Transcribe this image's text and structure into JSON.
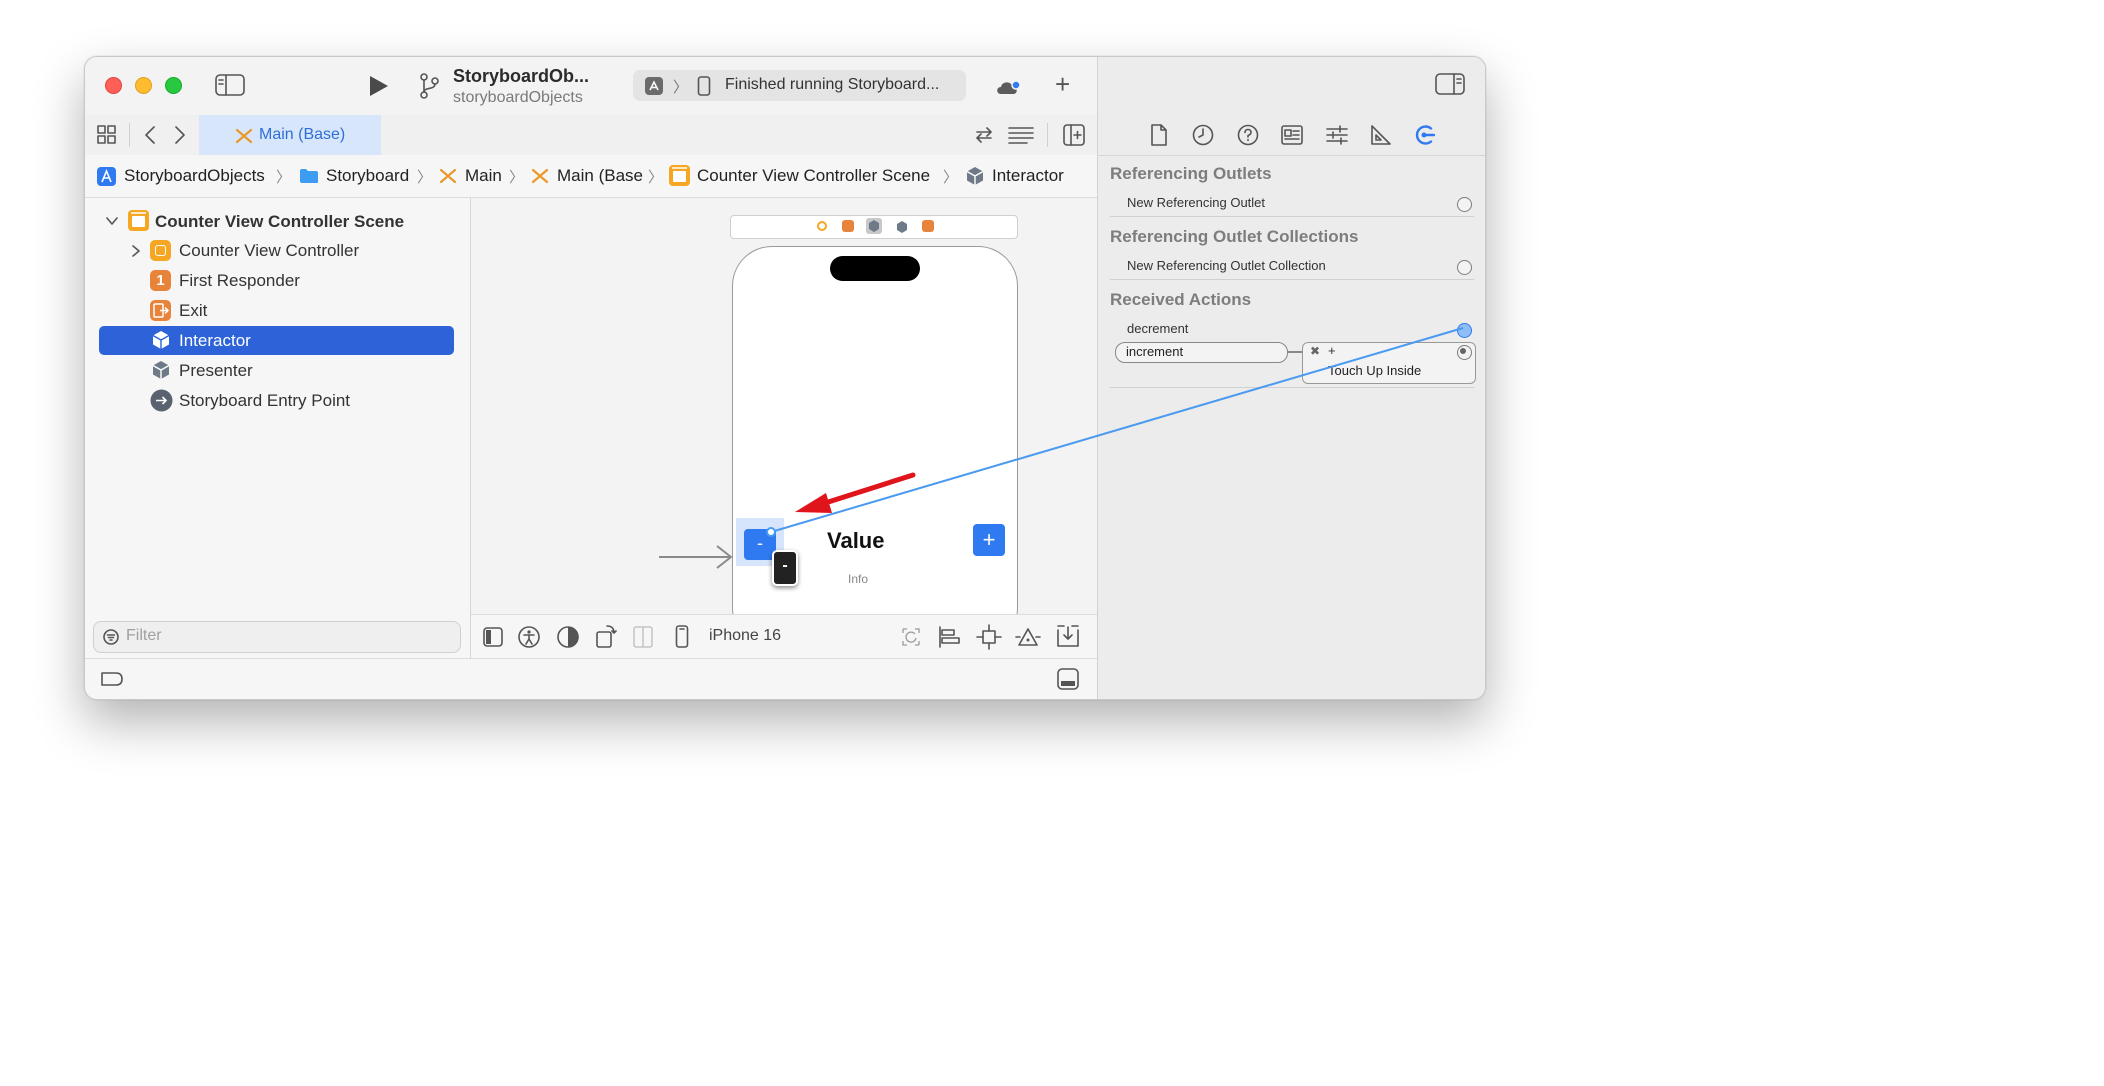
{
  "toolbar": {
    "project_name": "StoryboardOb...",
    "scheme_name": "storyboardObjects",
    "status_text": "Finished running Storyboard...",
    "add_label": "+"
  },
  "tabbar": {
    "active_tab": "Main (Base)"
  },
  "breadcrumb": [
    "StoryboardObjects",
    "Storyboard",
    "Main",
    "Main (Base",
    "Counter View Controller Scene",
    "Interactor"
  ],
  "navigator": {
    "scene": "Counter View Controller Scene",
    "items": [
      {
        "label": "Counter View Controller",
        "icon": "view-controller-icon"
      },
      {
        "label": "First Responder",
        "icon": "first-responder-icon"
      },
      {
        "label": "Exit",
        "icon": "exit-icon"
      },
      {
        "label": "Interactor",
        "icon": "object-cube-icon",
        "selected": true
      },
      {
        "label": "Presenter",
        "icon": "object-cube-icon"
      },
      {
        "label": "Storyboard Entry Point",
        "icon": "entry-point-icon"
      }
    ],
    "first_responder_badge": "1",
    "filter_placeholder": "Filter"
  },
  "canvas": {
    "minus_label": "-",
    "plus_label": "+",
    "value_label": "Value",
    "info_label": "Info",
    "tooltip_label": "-",
    "device": "iPhone 16"
  },
  "inspector": {
    "referencing_outlets_title": "Referencing Outlets",
    "new_referencing_outlet": "New Referencing Outlet",
    "referencing_outlet_collections_title": "Referencing Outlet Collections",
    "new_referencing_outlet_collection": "New Referencing Outlet Collection",
    "received_actions_title": "Received Actions",
    "actions": [
      "decrement",
      "increment"
    ],
    "connection_remove": "✖",
    "connection_target": "+",
    "connection_event": "Touch Up Inside"
  },
  "colors": {
    "accent": "#2d62d9",
    "button_blue": "#2f7af0",
    "connection_line": "#4a9af0",
    "annotation_arrow": "#e0141b"
  }
}
